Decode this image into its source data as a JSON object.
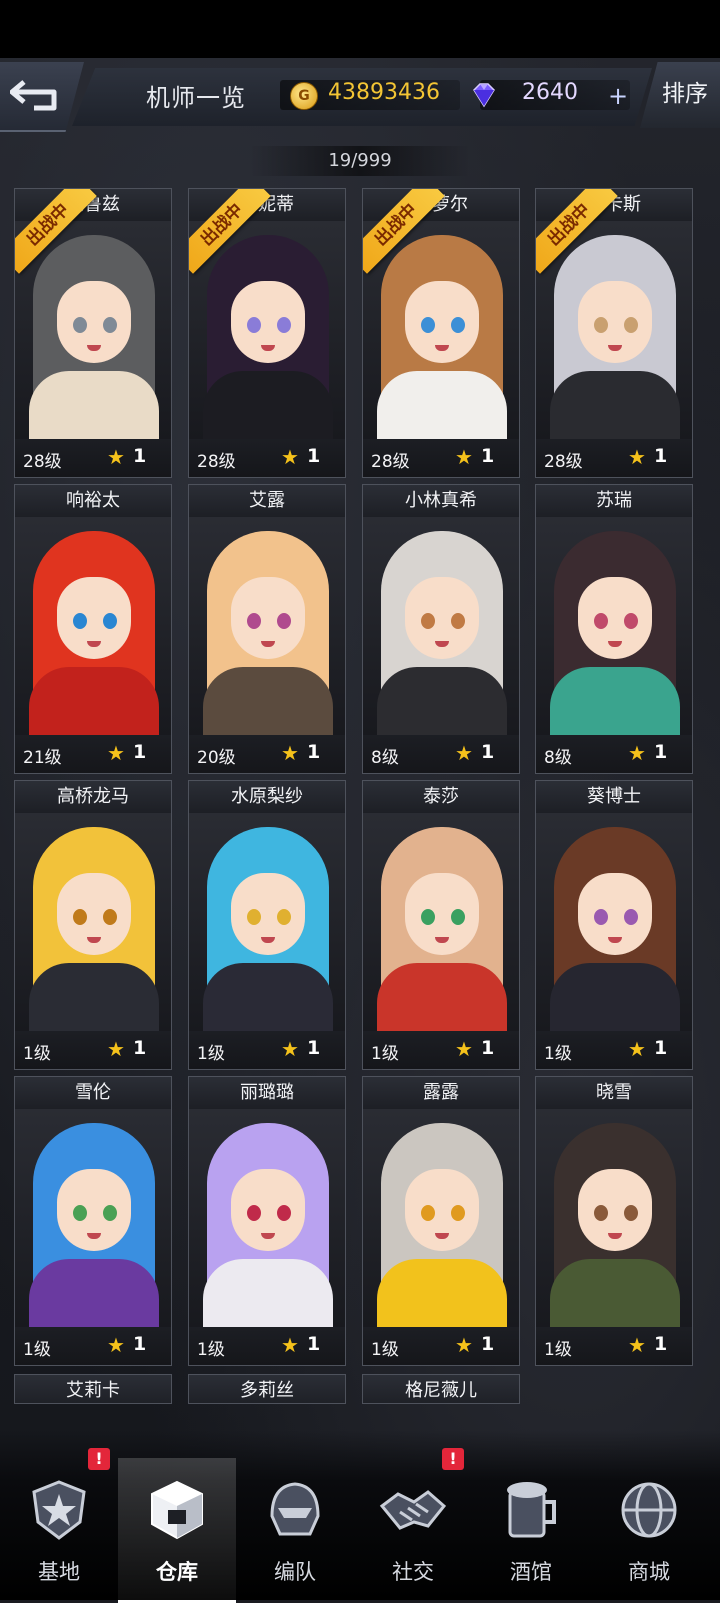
{
  "header": {
    "title": "机师一览",
    "gold": "43893436",
    "gems": "2640",
    "sort_label": "排序",
    "plus": "+",
    "coin_glyph": "G"
  },
  "counter": "19/999",
  "battle_label": "出战中",
  "pilots": [
    {
      "name": "妮鲁兹",
      "level": "28级",
      "stars": "1",
      "deployed": true,
      "hair": "#5c5d5f",
      "eyes": "#7f8a96",
      "outfit": "#e9dbc7"
    },
    {
      "name": "菲妮蒂",
      "level": "28级",
      "stars": "1",
      "deployed": true,
      "hair": "#2a1d33",
      "eyes": "#8a7cd8",
      "outfit": "#1c1c22"
    },
    {
      "name": "米萝尔",
      "level": "28级",
      "stars": "1",
      "deployed": true,
      "hair": "#b97a45",
      "eyes": "#3c8fd6",
      "outfit": "#f1efec"
    },
    {
      "name": "卢卡斯",
      "level": "28级",
      "stars": "1",
      "deployed": true,
      "hair": "#c9c9d2",
      "eyes": "#c9a070",
      "outfit": "#2a2b30"
    },
    {
      "name": "响裕太",
      "level": "21级",
      "stars": "1",
      "deployed": false,
      "hair": "#e0341f",
      "eyes": "#2a86d2",
      "outfit": "#c2221c"
    },
    {
      "name": "艾露",
      "level": "20级",
      "stars": "1",
      "deployed": false,
      "hair": "#f2c28c",
      "eyes": "#b04a8e",
      "outfit": "#5b4b3e"
    },
    {
      "name": "小林真希",
      "level": "8级",
      "stars": "1",
      "deployed": false,
      "hair": "#d8d4d0",
      "eyes": "#c07a44",
      "outfit": "#2c2c30"
    },
    {
      "name": "苏瑞",
      "level": "8级",
      "stars": "1",
      "deployed": false,
      "hair": "#3b2b30",
      "eyes": "#c04a6a",
      "outfit": "#3aa48e"
    },
    {
      "name": "高桥龙马",
      "level": "1级",
      "stars": "1",
      "deployed": false,
      "hair": "#f2c23a",
      "eyes": "#c07a1a",
      "outfit": "#2a2c34"
    },
    {
      "name": "水原梨纱",
      "level": "1级",
      "stars": "1",
      "deployed": false,
      "hair": "#3fb6e0",
      "eyes": "#e0b030",
      "outfit": "#2a2a36"
    },
    {
      "name": "泰莎",
      "level": "1级",
      "stars": "1",
      "deployed": false,
      "hair": "#e2b28e",
      "eyes": "#3aa060",
      "outfit": "#c9352a"
    },
    {
      "name": "葵博士",
      "level": "1级",
      "stars": "1",
      "deployed": false,
      "hair": "#6a3a26",
      "eyes": "#9a5ab0",
      "outfit": "#262630"
    },
    {
      "name": "雪伦",
      "level": "1级",
      "stars": "1",
      "deployed": false,
      "hair": "#3a8fe0",
      "eyes": "#4aa054",
      "outfit": "#6a3aa0"
    },
    {
      "name": "丽璐璐",
      "level": "1级",
      "stars": "1",
      "deployed": false,
      "hair": "#b9a2f0",
      "eyes": "#c02a4a",
      "outfit": "#eceaf0"
    },
    {
      "name": "露露",
      "level": "1级",
      "stars": "1",
      "deployed": false,
      "hair": "#cbc6c0",
      "eyes": "#e09a20",
      "outfit": "#f2c21c"
    },
    {
      "name": "晓雪",
      "level": "1级",
      "stars": "1",
      "deployed": false,
      "hair": "#3a302e",
      "eyes": "#8a5a3a",
      "outfit": "#4a5a34"
    }
  ],
  "partial_pilots": [
    "艾莉卡",
    "多莉丝",
    "格尼薇儿"
  ],
  "nav": [
    {
      "label": "基地",
      "icon": "base-emblem-icon",
      "alert": "!"
    },
    {
      "label": "仓库",
      "icon": "warehouse-cube-icon",
      "alert": ""
    },
    {
      "label": "编队",
      "icon": "formation-helmet-icon",
      "alert": ""
    },
    {
      "label": "社交",
      "icon": "handshake-icon",
      "alert": "!"
    },
    {
      "label": "酒馆",
      "icon": "tavern-mug-icon",
      "alert": ""
    },
    {
      "label": "商城",
      "icon": "shop-globe-icon",
      "alert": ""
    }
  ],
  "colors": {
    "gold_text": "#f3c534",
    "star": "#f5c21b",
    "ribbon": "#f0a81a",
    "alert": "#e3263a"
  }
}
